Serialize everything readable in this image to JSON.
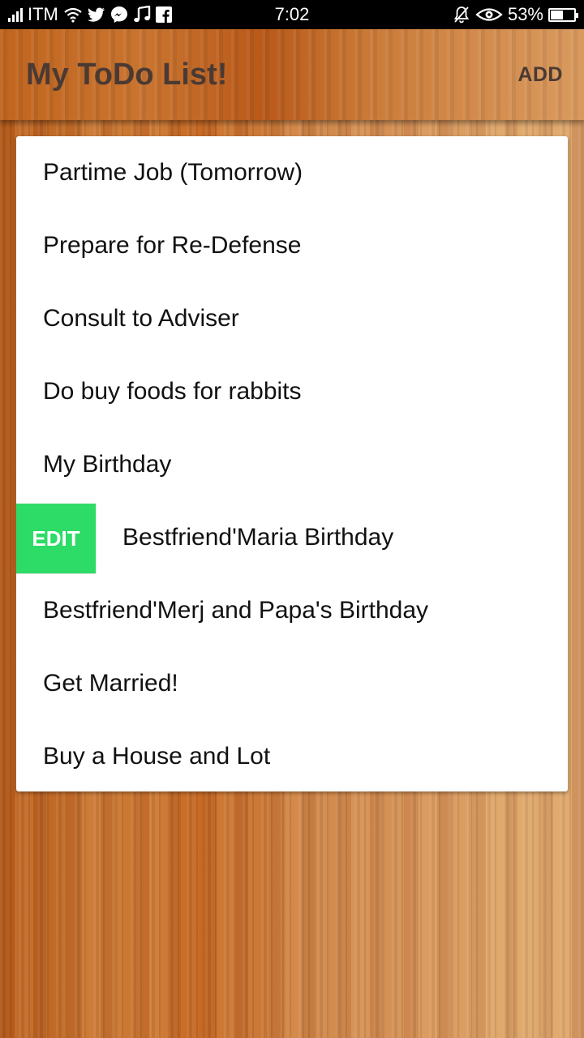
{
  "status_bar": {
    "carrier": "ITM",
    "time": "7:02",
    "battery_percent": "53%",
    "battery_level": 0.53,
    "left_icons": [
      "signal-icon",
      "wifi-icon",
      "twitter-icon",
      "messenger-icon",
      "music-icon",
      "facebook-icon"
    ],
    "right_icons": [
      "silent-bell-icon",
      "eye-icon",
      "battery-icon"
    ]
  },
  "app_bar": {
    "title": "My ToDo List!",
    "add_label": "ADD"
  },
  "todo": {
    "edit_label": "EDIT",
    "items": [
      {
        "text": "Partime Job (Tomorrow)"
      },
      {
        "text": "Prepare for Re-Defense"
      },
      {
        "text": "Consult to Adviser"
      },
      {
        "text": "Do buy foods for rabbits"
      },
      {
        "text": "My Birthday"
      },
      {
        "text": "Bestfriend'Maria Birthday",
        "swiped": true
      },
      {
        "text": "Bestfriend'Merj and Papa's Birthday"
      },
      {
        "text": "Get Married!"
      },
      {
        "text": "Buy a House and Lot"
      }
    ]
  },
  "colors": {
    "edit_action": "#2ddb67",
    "title_text": "#4a3a33"
  }
}
